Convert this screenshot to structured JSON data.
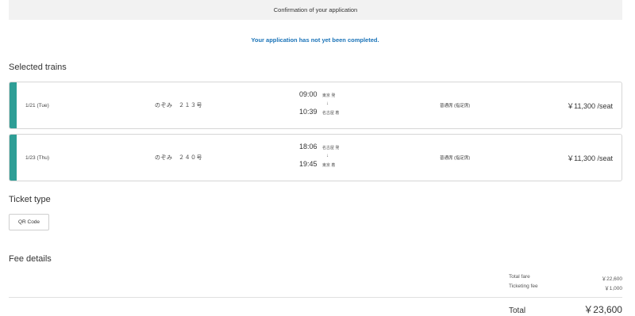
{
  "header": {
    "title": "Confirmation of your application"
  },
  "notice": "Your application has not yet been completed.",
  "selected_trains": {
    "heading": "Selected trains",
    "trains": [
      {
        "date": "1/21 (Tue)",
        "name": "のぞみ　２１３号",
        "depart_time": "09:00",
        "depart_station": "東京 発",
        "arrow": "↓",
        "arrive_time": "10:39",
        "arrive_station": "名古屋 着",
        "seat_type": "普通席 (指定席)",
        "price": "￥11,300 /seat"
      },
      {
        "date": "1/23 (Thu)",
        "name": "のぞみ　２４０号",
        "depart_time": "18:06",
        "depart_station": "名古屋 発",
        "arrow": "↓",
        "arrive_time": "19:45",
        "arrive_station": "東京 着",
        "seat_type": "普通席 (指定席)",
        "price": "￥11,300 /seat"
      }
    ]
  },
  "ticket_type": {
    "heading": "Ticket type",
    "selected": "QR Code"
  },
  "fee_details": {
    "heading": "Fee details",
    "total_fare_label": "Total fare",
    "total_fare_value": "￥22,600",
    "ticketing_fee_label": "Ticketing fee",
    "ticketing_fee_value": "￥1,000",
    "total_label": "Total",
    "total_value": "￥23,600"
  },
  "colors": {
    "accent": "#2e9e96",
    "notice": "#1a73b8",
    "header_bg": "#f2f2f2"
  }
}
